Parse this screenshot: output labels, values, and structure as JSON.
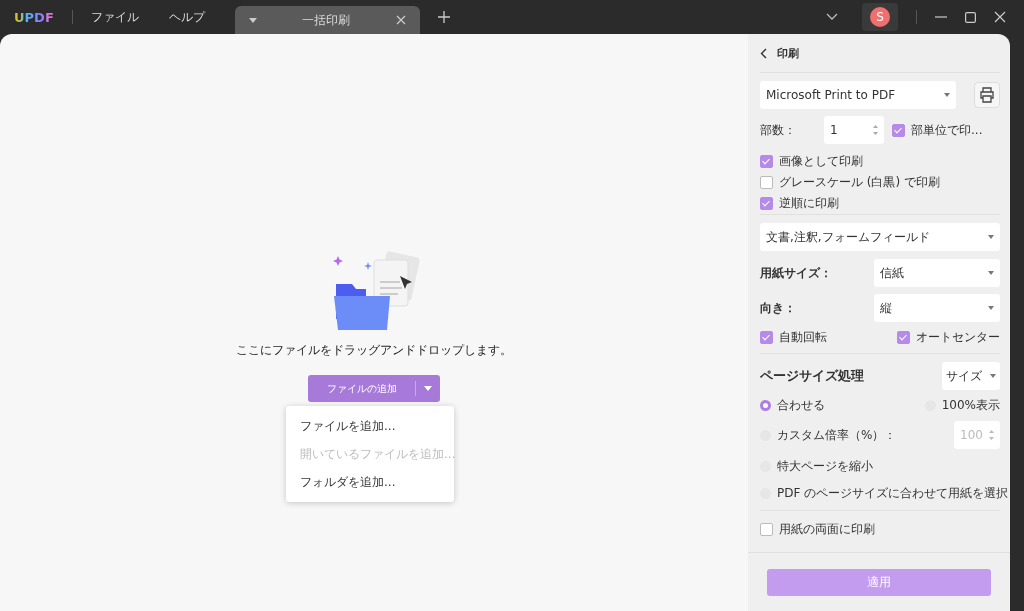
{
  "titlebar": {
    "logo": "UPDF",
    "menus": [
      "ファイル",
      "ヘルプ"
    ],
    "tabs": [
      {
        "title": "一括印刷",
        "selected": true
      }
    ],
    "avatar": "S"
  },
  "dropzone": {
    "hint": "ここにファイルをドラッグアンドドロップします。",
    "add_button": "ファイルの追加",
    "menu": [
      {
        "label": "ファイルを追加...",
        "disabled": false
      },
      {
        "label": "開いているファイルを追加...",
        "disabled": true
      },
      {
        "label": "フォルダを追加...",
        "disabled": false
      }
    ]
  },
  "panel": {
    "title": "印刷",
    "printer": "Microsoft Print to PDF",
    "copies_label": "部数：",
    "copies": "1",
    "collate": {
      "label": "部単位で印...",
      "checked": true
    },
    "options": [
      {
        "label": "画像として印刷",
        "checked": true
      },
      {
        "label": "グレースケール (白黒) で印刷",
        "checked": false
      },
      {
        "label": "逆順に印刷",
        "checked": true
      }
    ],
    "content": "文書,注釈,フォームフィールド",
    "paper_label": "用紙サイズ：",
    "paper": "信紙",
    "orientation_label": "向き：",
    "orientation": "縦",
    "auto": [
      {
        "label": "自動回転",
        "checked": true
      },
      {
        "label": "オートセンター",
        "checked": true
      }
    ],
    "page_size_label": "ページサイズ処理",
    "page_size_mode": "サイズ",
    "radios": [
      {
        "label": "合わせる",
        "selected": true
      },
      {
        "label": "100%表示",
        "selected": false
      },
      {
        "label": "カスタム倍率（%）：",
        "selected": false,
        "value": "100"
      },
      {
        "label": "特大ページを縮小",
        "selected": false
      },
      {
        "label": "PDF のページサイズに合わせて用紙を選択",
        "selected": false
      }
    ],
    "duplex": {
      "label": "用紙の両面に印刷",
      "checked": false
    },
    "apply": {
      "label": "適用",
      "disabled": true
    }
  }
}
